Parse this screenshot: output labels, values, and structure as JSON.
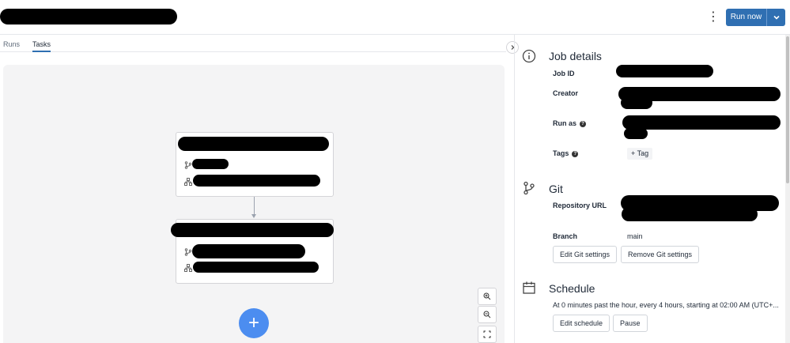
{
  "header": {
    "menu_glyph": "⋮",
    "run_now_label": "Run now",
    "kebab_icon": "more-vertical-icon",
    "dropdown_icon": "chevron-down-icon",
    "primary_color": "#2f6fb2"
  },
  "tabs": [
    {
      "label": "Runs",
      "active": false
    },
    {
      "label": "Tasks",
      "active": true
    }
  ],
  "canvas": {
    "add_glyph": "+",
    "add_color": "#4c8df0",
    "nodes": [
      {
        "branch_icon": "git-branch-icon",
        "cluster_icon": "cluster-icon"
      },
      {
        "branch_icon": "git-branch-icon",
        "cluster_icon": "cluster-icon"
      }
    ],
    "zoom_controls": [
      "zoom-in-icon",
      "zoom-out-icon",
      "fit-view-icon"
    ]
  },
  "panel": {
    "job_details": {
      "title": "Job details",
      "icon": "info-icon",
      "job_id_label": "Job ID",
      "creator_label": "Creator",
      "run_as_label": "Run as",
      "tags_label": "Tags",
      "add_tag_label": "+ Tag",
      "help_glyph": "?"
    },
    "git": {
      "title": "Git",
      "icon": "git-branch-icon",
      "repo_label": "Repository URL",
      "branch_label": "Branch",
      "branch_value": "main",
      "edit_label": "Edit Git settings",
      "remove_label": "Remove Git settings"
    },
    "schedule": {
      "title": "Schedule",
      "icon": "calendar-icon",
      "description": "At 0 minutes past the hour, every 4 hours, starting at 02:00 AM (UTC+...",
      "edit_label": "Edit schedule",
      "pause_label": "Pause"
    }
  }
}
